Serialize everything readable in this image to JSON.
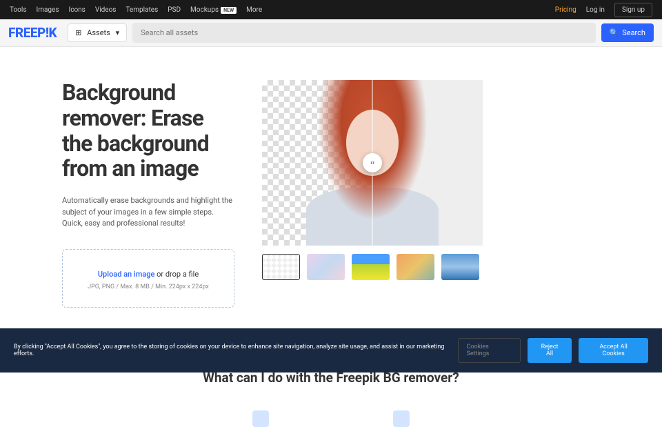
{
  "topnav": {
    "links": [
      "Tools",
      "Images",
      "Icons",
      "Videos",
      "Templates",
      "PSD",
      "Mockups"
    ],
    "new_badge": "NEW",
    "more": "More",
    "pricing": "Pricing",
    "login": "Log in",
    "signup": "Sign up"
  },
  "navbar": {
    "logo": "FREEP!K",
    "assets_label": "Assets",
    "search_placeholder": "Search all assets",
    "search_btn": "Search"
  },
  "hero": {
    "title": "Background remover: Erase the background from an image",
    "subtitle": "Automatically erase backgrounds and highlight the subject of your images in a few simple steps. Quick, easy and professional results!",
    "upload_link": "Upload an image",
    "upload_text": " or drop a file",
    "upload_hint": "JPG, PNG / Max. 8 MB / Min. 224px x 224px"
  },
  "section2": {
    "title": "What can I do with the Freepik BG remover?"
  },
  "cookie": {
    "text": "By clicking \"Accept All Cookies\", you agree to the storing of cookies on your device to enhance site navigation, analyze site usage, and assist in our marketing efforts.",
    "settings": "Cookies Settings",
    "reject": "Reject All",
    "accept": "Accept All Cookies"
  }
}
